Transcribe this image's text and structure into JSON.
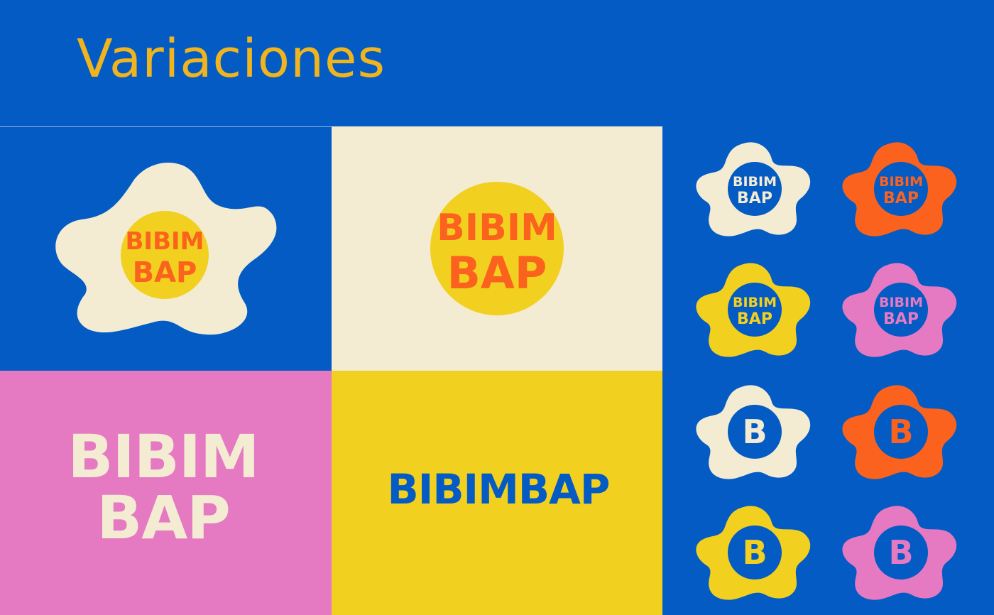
{
  "title": "Variaciones",
  "brand": {
    "line1": "BIBIM",
    "line2": "BAP",
    "full": "BIBIMBAP",
    "monogram": "B"
  },
  "colors": {
    "blue": "#035bc3",
    "cream": "#f3ecd3",
    "yellow": "#f2d01f",
    "orange": "#fb621e",
    "pink": "#e579c2",
    "gold": "#f0b41e"
  },
  "variants": [
    {
      "egg": "cream",
      "inner": "blue",
      "text": "cream",
      "mark": "wordmark"
    },
    {
      "egg": "orange",
      "inner": "blue",
      "text": "orange",
      "mark": "wordmark"
    },
    {
      "egg": "yellow",
      "inner": "blue",
      "text": "yellow",
      "mark": "wordmark"
    },
    {
      "egg": "pink",
      "inner": "blue",
      "text": "pink",
      "mark": "wordmark"
    },
    {
      "egg": "cream",
      "inner": "blue",
      "text": "cream",
      "mark": "monogram"
    },
    {
      "egg": "orange",
      "inner": "blue",
      "text": "orange",
      "mark": "monogram"
    },
    {
      "egg": "yellow",
      "inner": "blue",
      "text": "yellow",
      "mark": "monogram"
    },
    {
      "egg": "pink",
      "inner": "blue",
      "text": "pink",
      "mark": "monogram"
    }
  ]
}
